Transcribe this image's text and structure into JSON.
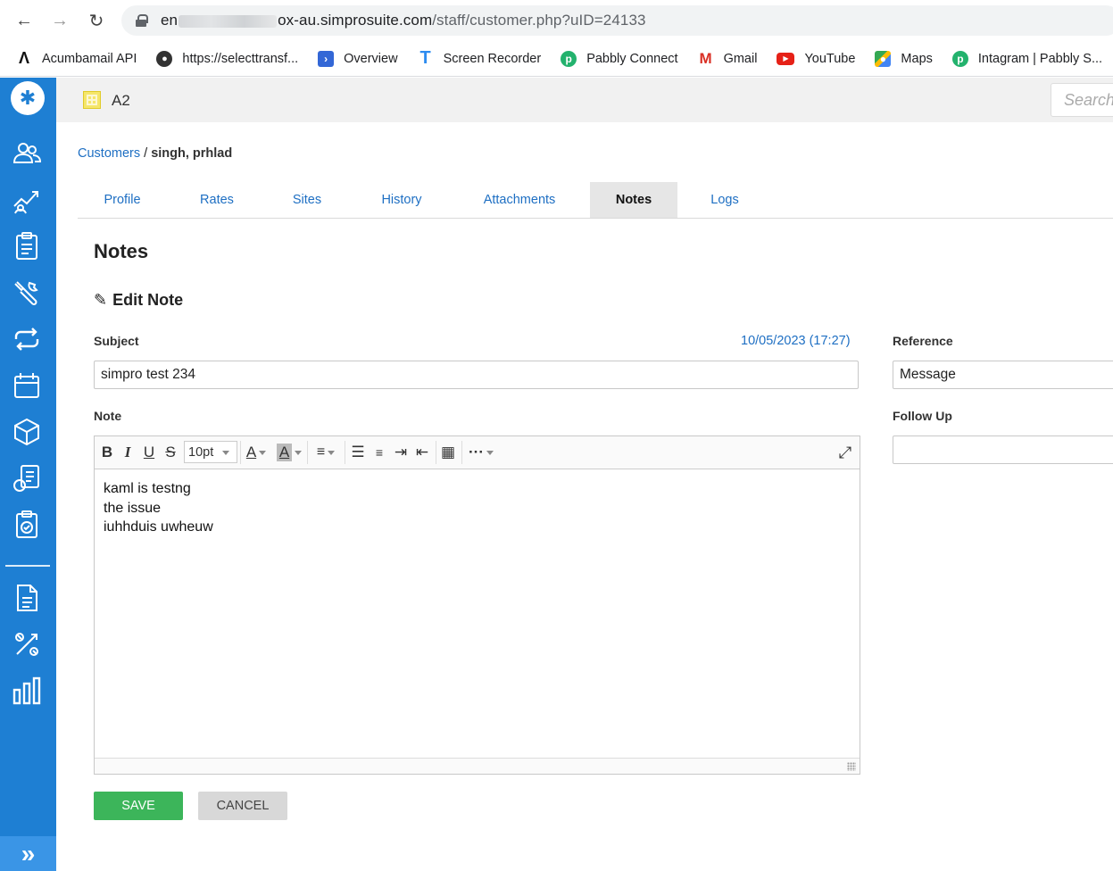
{
  "browser": {
    "url_prefix": "en",
    "url_domain": "ox-au.simprosuite.com",
    "url_path": "/staff/customer.php?uID=24133",
    "bookmarks": [
      {
        "label": "Acumbamail API",
        "icon": "acumbamail-logo"
      },
      {
        "label": "https://selecttransf...",
        "icon": "globe-icon"
      },
      {
        "label": "Overview",
        "icon": "overview-icon"
      },
      {
        "label": "Screen Recorder",
        "icon": "screen-recorder-icon"
      },
      {
        "label": "Pabbly Connect",
        "icon": "pabbly-icon"
      },
      {
        "label": "Gmail",
        "icon": "gmail-icon"
      },
      {
        "label": "YouTube",
        "icon": "youtube-icon"
      },
      {
        "label": "Maps",
        "icon": "maps-icon"
      },
      {
        "label": "Intagram | Pabbly S...",
        "icon": "pabbly-icon"
      }
    ]
  },
  "header": {
    "company": "A2",
    "search_placeholder": "Search"
  },
  "breadcrumb": {
    "parent": "Customers",
    "separator": "/",
    "current": "singh, prhlad"
  },
  "tabs": [
    {
      "label": "Profile"
    },
    {
      "label": "Rates"
    },
    {
      "label": "Sites"
    },
    {
      "label": "History"
    },
    {
      "label": "Attachments"
    },
    {
      "label": "Notes",
      "active": true
    },
    {
      "label": "Logs"
    }
  ],
  "form": {
    "section_title": "Notes",
    "edit_title": "Edit Note",
    "subject_label": "Subject",
    "subject_value": "simpro test 234",
    "timestamp": "10/05/2023 (17:27)",
    "reference_label": "Reference",
    "reference_value": "Message",
    "note_label": "Note",
    "follow_up_label": "Follow Up",
    "follow_up_value": "",
    "font_size": "10pt",
    "note_lines": [
      "kaml is testng",
      "the issue",
      "iuhhduis uwheuw"
    ],
    "save_label": "SAVE",
    "cancel_label": "CANCEL"
  },
  "colors": {
    "rail": "#1e7fd3",
    "link": "#1e6fc3",
    "save": "#3cb55a"
  }
}
